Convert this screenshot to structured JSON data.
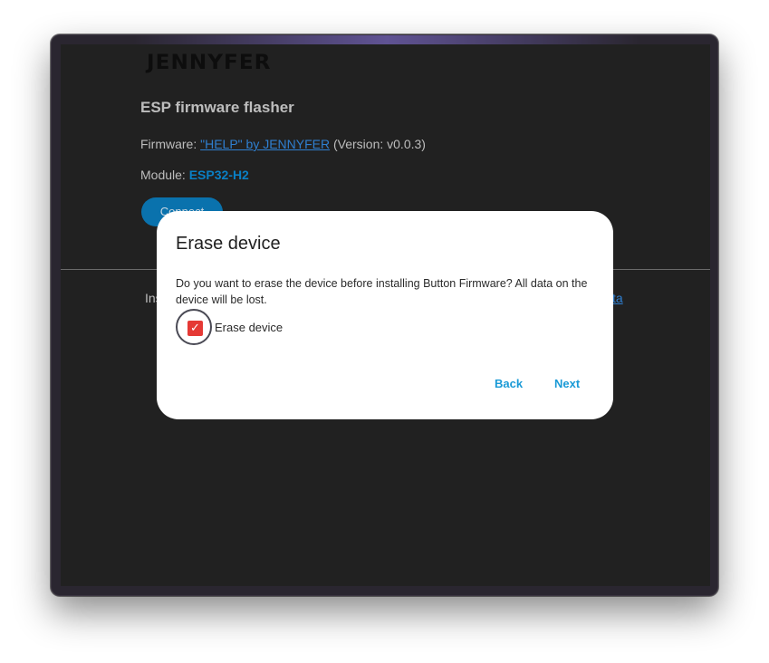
{
  "logo": {
    "text": "JENNYFER"
  },
  "page": {
    "heading": "ESP firmware flasher",
    "firmware_label": "Firmware: ",
    "firmware_link": "\"HELP\" by JENNYFER",
    "firmware_version": " (Version: v0.0.3)",
    "module_label": "Module: ",
    "module_value": "ESP32-H2",
    "connect_label": "Connect",
    "install_text_fragment": "Ins",
    "link_fragment": "ta"
  },
  "dialog": {
    "title": "Erase device",
    "message": "Do you want to erase the device before installing Button Firmware? All data on the device will be lost.",
    "checkbox_label": "Erase device",
    "checkbox_checked": true,
    "back_label": "Back",
    "next_label": "Next"
  },
  "colors": {
    "accent": "#1a9ad6",
    "checkbox": "#e53935",
    "page_bg": "#212121",
    "connect_button": "#0a72ad",
    "module_value": "#0a7fc4"
  },
  "icons": {
    "checkbox": "checkmark-icon"
  }
}
